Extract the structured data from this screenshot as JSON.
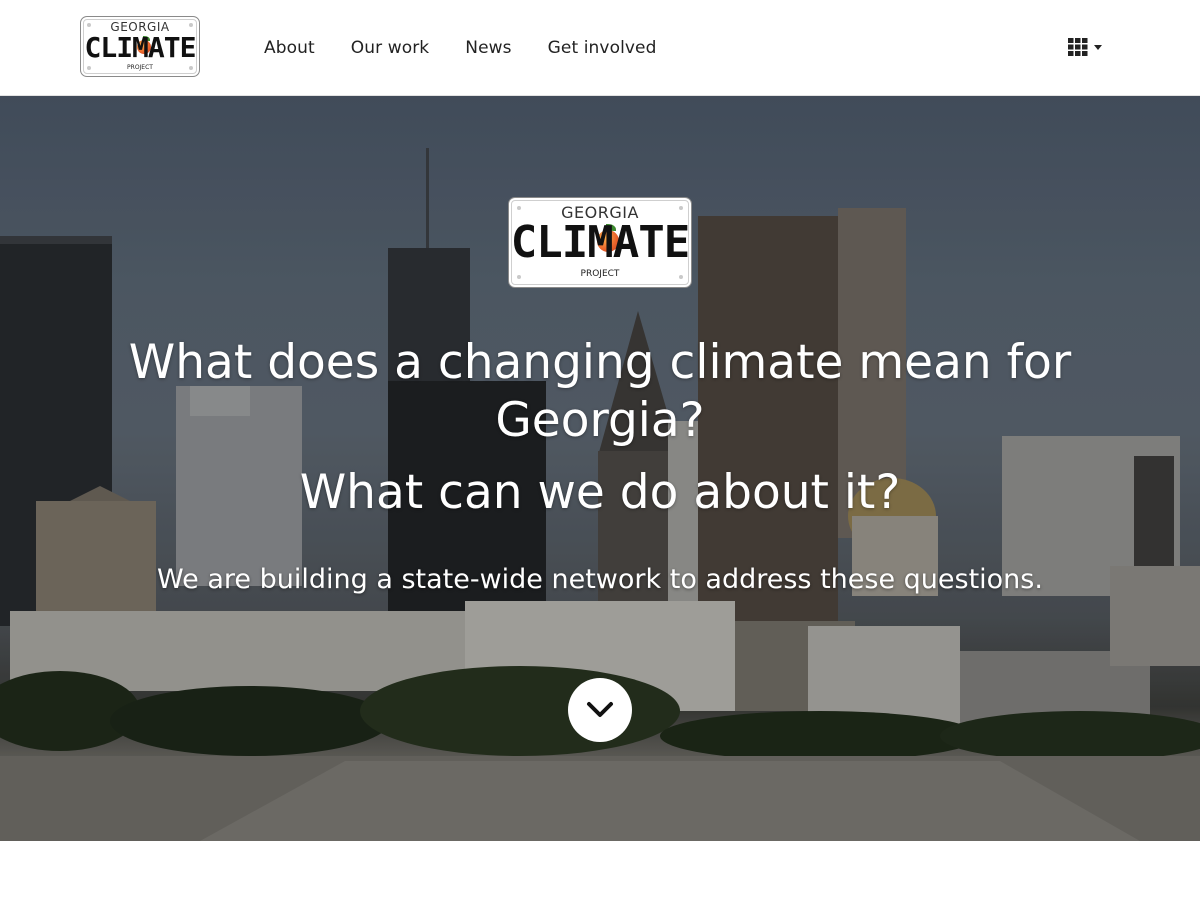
{
  "nav": {
    "logo": {
      "top": "GEORGIA",
      "main": "CLIMATE",
      "sub": "PROJECT"
    },
    "links": [
      {
        "label": "About"
      },
      {
        "label": "Our work"
      },
      {
        "label": "News"
      },
      {
        "label": "Get involved"
      }
    ],
    "menu_icon": "grid-icon",
    "menu_caret_icon": "caret-down-icon"
  },
  "hero": {
    "logo": {
      "top": "GEORGIA",
      "main": "CLIMATE",
      "sub": "PROJECT"
    },
    "headline_1": "What does a changing climate mean for Georgia?",
    "headline_2": "What can we do about it?",
    "subheadline": "We are building a state-wide network to address these questions.",
    "scroll_icon": "chevron-down-icon"
  },
  "colors": {
    "nav_background": "#ffffff",
    "nav_text": "#222222",
    "hero_text": "#ffffff",
    "scroll_button": "#ffffff"
  }
}
